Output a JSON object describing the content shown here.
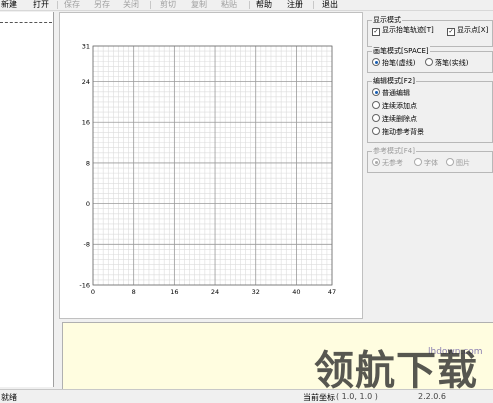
{
  "menu": {
    "items": [
      {
        "label": "新建",
        "enabled": true
      },
      {
        "label": "打开",
        "enabled": true
      },
      {
        "label": "保存",
        "enabled": false
      },
      {
        "label": "另存",
        "enabled": false
      },
      {
        "label": "关闭",
        "enabled": false
      },
      {
        "label": "剪切",
        "enabled": false
      },
      {
        "label": "复制",
        "enabled": false
      },
      {
        "label": "粘贴",
        "enabled": false
      },
      {
        "label": "帮助",
        "enabled": true
      },
      {
        "label": "注册",
        "enabled": true
      },
      {
        "label": "退出",
        "enabled": true
      }
    ]
  },
  "chart_data": {
    "type": "scatter",
    "x_ticks": [
      "0",
      "8",
      "16",
      "24",
      "32",
      "40",
      "47"
    ],
    "y_ticks": [
      "31",
      "24",
      "16",
      "8",
      "0",
      "-8",
      "-16"
    ],
    "xlim": [
      0,
      47
    ],
    "ylim": [
      -16,
      31
    ],
    "grid": true,
    "values": []
  },
  "display_mode": {
    "title": "显示模式",
    "show_trace": {
      "label": "显示抬笔轨迹[T]",
      "checked": true
    },
    "show_points": {
      "label": "显示点[X]",
      "checked": true
    }
  },
  "pen_mode": {
    "title": "画笔模式[SPACE]",
    "options": [
      {
        "label": "抬笔(虚线)",
        "selected": true
      },
      {
        "label": "落笔(实线)",
        "selected": false
      }
    ]
  },
  "edit_mode": {
    "title": "编辑模式[F2]",
    "options": [
      {
        "label": "普通编辑",
        "selected": true
      },
      {
        "label": "连续添加点",
        "selected": false
      },
      {
        "label": "连续删除点",
        "selected": false
      },
      {
        "label": "拖动参考背景",
        "selected": false
      }
    ]
  },
  "ref_mode": {
    "title": "参考模式[F4]",
    "options": [
      {
        "label": "无参考",
        "selected": true
      },
      {
        "label": "字体",
        "selected": false
      },
      {
        "label": "图片",
        "selected": false
      }
    ]
  },
  "status": {
    "text": "就绪",
    "coord_label": "当前坐标",
    "coord_value": "( 1.0, 1.0 )",
    "version": "2.2.0.6"
  },
  "watermark": {
    "url": "lhdown.com",
    "text": "领航下载"
  },
  "colors": {
    "grid_minor": "#dcdcdc",
    "grid_major": "#9a9a9a",
    "accent": "#1a5fb4",
    "notes_bg": "#fffde0"
  }
}
